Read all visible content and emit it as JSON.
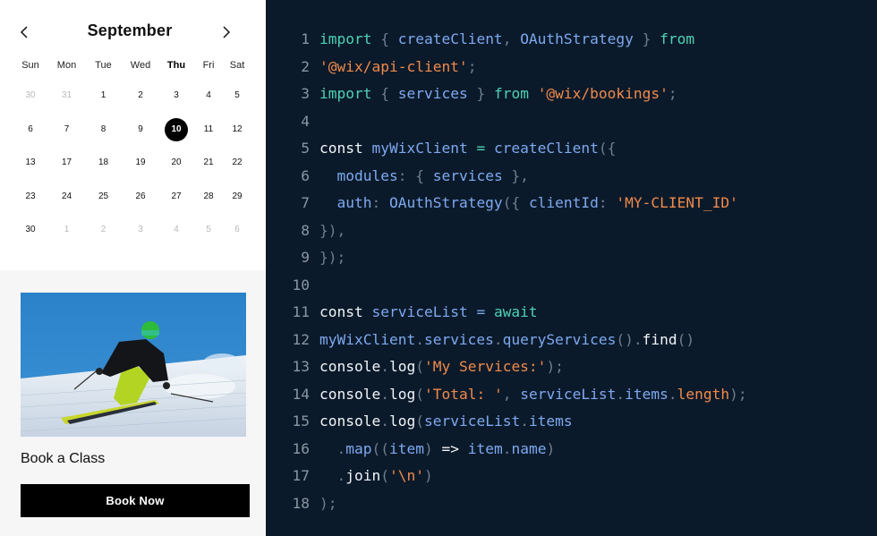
{
  "calendar": {
    "month": "September",
    "prev_label": "Previous month",
    "next_label": "Next month",
    "weekdays": [
      "Sun",
      "Mon",
      "Tue",
      "Wed",
      "Thu",
      "Fri",
      "Sat"
    ],
    "today_weekday_index": 4,
    "weeks": [
      [
        {
          "d": "30",
          "muted": true
        },
        {
          "d": "31",
          "muted": true
        },
        {
          "d": "1"
        },
        {
          "d": "2"
        },
        {
          "d": "3"
        },
        {
          "d": "4"
        },
        {
          "d": "5"
        }
      ],
      [
        {
          "d": "6"
        },
        {
          "d": "7"
        },
        {
          "d": "8"
        },
        {
          "d": "9"
        },
        {
          "d": "10",
          "selected": true
        },
        {
          "d": "11"
        },
        {
          "d": "12"
        }
      ],
      [
        {
          "d": "13"
        },
        {
          "d": "17"
        },
        {
          "d": "18"
        },
        {
          "d": "19"
        },
        {
          "d": "20"
        },
        {
          "d": "21"
        },
        {
          "d": "22"
        }
      ],
      [
        {
          "d": "23"
        },
        {
          "d": "24"
        },
        {
          "d": "25"
        },
        {
          "d": "26"
        },
        {
          "d": "27"
        },
        {
          "d": "28"
        },
        {
          "d": "29"
        }
      ],
      [
        {
          "d": "30"
        },
        {
          "d": "1",
          "muted": true
        },
        {
          "d": "2",
          "muted": true
        },
        {
          "d": "3",
          "muted": true
        },
        {
          "d": "4",
          "muted": true
        },
        {
          "d": "5",
          "muted": true
        },
        {
          "d": "6",
          "muted": true
        }
      ]
    ]
  },
  "card": {
    "image_alt": "Skier carving down a groomed slope",
    "title": "Book a Class",
    "button_label": "Book Now"
  },
  "code": {
    "colors": {
      "background": "#0b1a2a",
      "keyword": "#4fd1b3",
      "identifier": "#7ea9f0",
      "string": "#f08a4b",
      "punctuation": "#6f7d8c",
      "plain": "#f2f5f8",
      "line_number": "#8a96a3"
    },
    "lines": [
      {
        "n": "1",
        "tokens": [
          [
            "kw",
            "import"
          ],
          [
            "pun",
            " { "
          ],
          [
            "id",
            "createClient"
          ],
          [
            "pun",
            ", "
          ],
          [
            "id",
            "OAuthStrategy"
          ],
          [
            "pun",
            " } "
          ],
          [
            "kw",
            "from"
          ]
        ]
      },
      {
        "n": "2",
        "tokens": [
          [
            "str",
            "'@wix/api-client'"
          ],
          [
            "pun",
            ";"
          ]
        ]
      },
      {
        "n": "3",
        "tokens": [
          [
            "kw",
            "import"
          ],
          [
            "pun",
            " { "
          ],
          [
            "id",
            "services"
          ],
          [
            "pun",
            " } "
          ],
          [
            "kw",
            "from"
          ],
          [
            "pun",
            " "
          ],
          [
            "str",
            "'@wix/bookings'"
          ],
          [
            "pun",
            ";"
          ]
        ]
      },
      {
        "n": "4",
        "tokens": []
      },
      {
        "n": "5",
        "tokens": [
          [
            "plain",
            "const"
          ],
          [
            "pun",
            " "
          ],
          [
            "id",
            "myWixClient"
          ],
          [
            "pun",
            " "
          ],
          [
            "op",
            "="
          ],
          [
            "pun",
            " "
          ],
          [
            "id",
            "createClient"
          ],
          [
            "pun",
            "({"
          ]
        ]
      },
      {
        "n": "6",
        "tokens": [
          [
            "pun",
            "  "
          ],
          [
            "id",
            "modules"
          ],
          [
            "pun",
            ": { "
          ],
          [
            "id",
            "services"
          ],
          [
            "pun",
            " },"
          ]
        ]
      },
      {
        "n": "7",
        "tokens": [
          [
            "pun",
            "  "
          ],
          [
            "id",
            "auth"
          ],
          [
            "pun",
            ": "
          ],
          [
            "id",
            "OAuthStrategy"
          ],
          [
            "pun",
            "({ "
          ],
          [
            "id",
            "clientId"
          ],
          [
            "pun",
            ": "
          ],
          [
            "str",
            "'MY-CLIENT_ID'"
          ]
        ]
      },
      {
        "n": "8",
        "tokens": [
          [
            "pun",
            "}),"
          ]
        ]
      },
      {
        "n": "9",
        "tokens": [
          [
            "pun",
            "});"
          ]
        ]
      },
      {
        "n": "10",
        "tokens": []
      },
      {
        "n": "11",
        "tokens": [
          [
            "plain",
            "const"
          ],
          [
            "pun",
            " "
          ],
          [
            "id",
            "serviceList"
          ],
          [
            "pun",
            " "
          ],
          [
            "id",
            "="
          ],
          [
            "pun",
            " "
          ],
          [
            "kw",
            "await"
          ]
        ]
      },
      {
        "n": "12",
        "tokens": [
          [
            "id",
            "myWixClient"
          ],
          [
            "pun",
            "."
          ],
          [
            "id",
            "services"
          ],
          [
            "pun",
            "."
          ],
          [
            "id",
            "queryServices"
          ],
          [
            "pun",
            "()."
          ],
          [
            "plain",
            "find"
          ],
          [
            "pun",
            "()"
          ]
        ]
      },
      {
        "n": "13",
        "tokens": [
          [
            "plain",
            "console"
          ],
          [
            "pun",
            "."
          ],
          [
            "plain",
            "log"
          ],
          [
            "pun",
            "("
          ],
          [
            "str",
            "'My Services:'"
          ],
          [
            "pun",
            ");"
          ]
        ]
      },
      {
        "n": "14",
        "tokens": [
          [
            "plain",
            "console"
          ],
          [
            "pun",
            "."
          ],
          [
            "plain",
            "log"
          ],
          [
            "pun",
            "("
          ],
          [
            "str",
            "'Total: '"
          ],
          [
            "pun",
            ", "
          ],
          [
            "id",
            "serviceList"
          ],
          [
            "pun",
            "."
          ],
          [
            "id",
            "items"
          ],
          [
            "pun",
            "."
          ],
          [
            "str",
            "length"
          ],
          [
            "pun",
            ");"
          ]
        ]
      },
      {
        "n": "15",
        "tokens": [
          [
            "plain",
            "console"
          ],
          [
            "pun",
            "."
          ],
          [
            "plain",
            "log"
          ],
          [
            "pun",
            "("
          ],
          [
            "id",
            "serviceList"
          ],
          [
            "pun",
            "."
          ],
          [
            "id",
            "items"
          ]
        ]
      },
      {
        "n": "16",
        "tokens": [
          [
            "pun",
            "  ."
          ],
          [
            "id",
            "map"
          ],
          [
            "pun",
            "(("
          ],
          [
            "id",
            "item"
          ],
          [
            "pun",
            ") "
          ],
          [
            "plain",
            "=>"
          ],
          [
            "pun",
            " "
          ],
          [
            "id",
            "item"
          ],
          [
            "pun",
            "."
          ],
          [
            "id",
            "name"
          ],
          [
            "pun",
            ")"
          ]
        ]
      },
      {
        "n": "17",
        "tokens": [
          [
            "pun",
            "  ."
          ],
          [
            "plain",
            "join"
          ],
          [
            "pun",
            "("
          ],
          [
            "str",
            "'\\n'"
          ],
          [
            "pun",
            ")"
          ]
        ]
      },
      {
        "n": "18",
        "tokens": [
          [
            "pun",
            ");"
          ]
        ]
      }
    ]
  }
}
